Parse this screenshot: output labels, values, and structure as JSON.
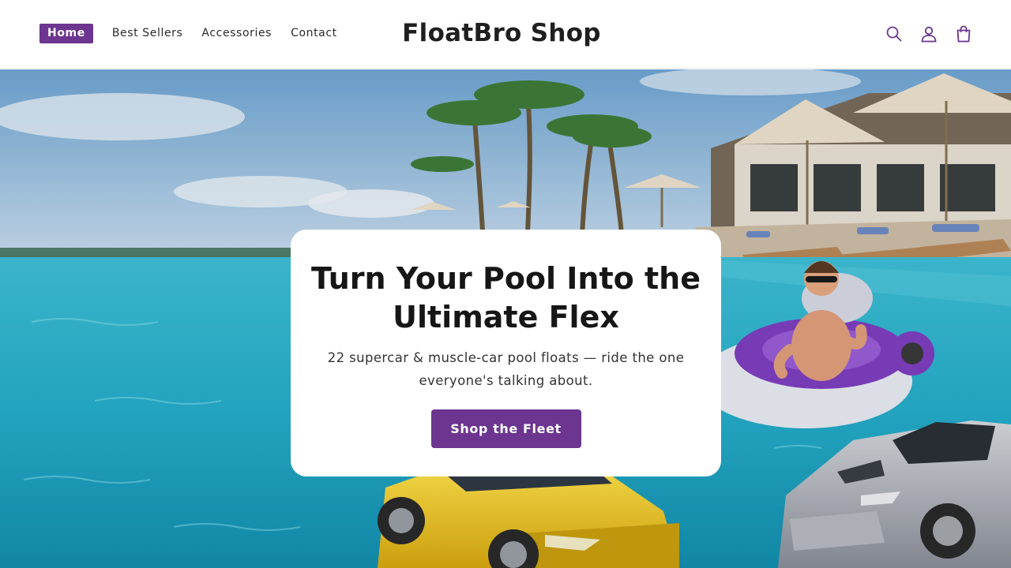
{
  "brand": {
    "title": "FloatBro Shop",
    "accent_color": "#6b3590"
  },
  "nav": {
    "items": [
      {
        "label": "Home",
        "active": true
      },
      {
        "label": "Best Sellers",
        "active": false
      },
      {
        "label": "Accessories",
        "active": false
      },
      {
        "label": "Contact",
        "active": false
      }
    ]
  },
  "header_icons": [
    "search-icon",
    "account-icon",
    "cart-icon"
  ],
  "hero": {
    "headline": "Turn Your Pool Into the Ultimate Flex",
    "subheadline": "22 supercar & muscle-car pool floats — ride the one everyone's talking about.",
    "cta_label": "Shop the Fleet"
  }
}
